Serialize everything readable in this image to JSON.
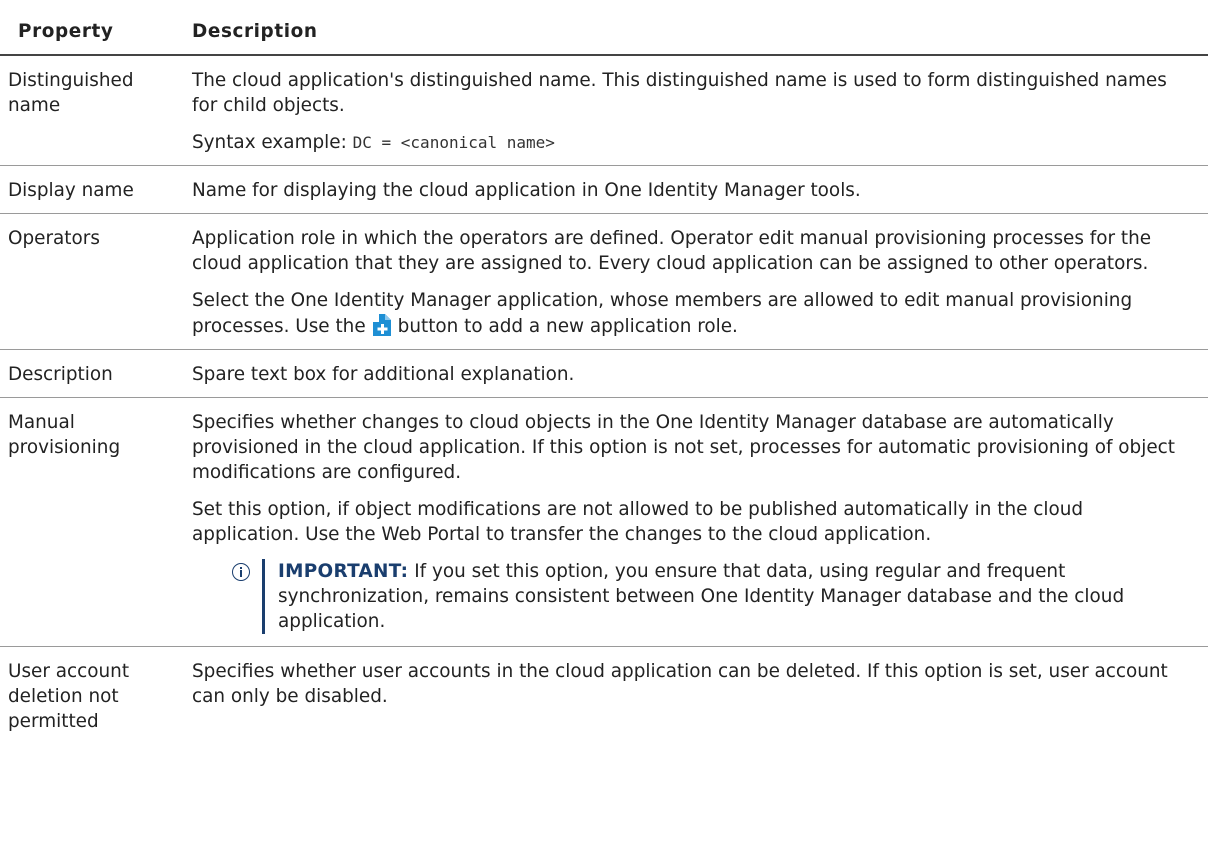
{
  "table": {
    "headers": {
      "property": "Property",
      "description": "Description"
    },
    "rows": [
      {
        "property": "Distinguished name",
        "paragraphs": [
          "The cloud application's distinguished name. This distinguished name is used to form distinguished names for child objects."
        ],
        "syntax": {
          "label": "Syntax example: ",
          "code": "DC = <canonical name>"
        }
      },
      {
        "property": "Display name",
        "paragraphs": [
          "Name for displaying the cloud application in One Identity Manager tools."
        ]
      },
      {
        "property": "Operators",
        "paragraphs": [
          "Application role in which the operators are defined. Operator edit manual provisioning processes for the cloud application that they are assigned to. Every cloud application can be assigned to other operators."
        ],
        "icon_paragraph": {
          "before": "Select the One Identity Manager application, whose members are allowed to edit manual provisioning processes. Use the",
          "icon": "add-application-role-icon",
          "after": "button to add a new application role."
        }
      },
      {
        "property": "Description",
        "paragraphs": [
          "Spare text box for additional explanation."
        ]
      },
      {
        "property": "Manual provisioning",
        "paragraphs": [
          "Specifies whether changes to cloud objects in the One Identity Manager database are automatically provisioned in the cloud application. If this option is not set, processes for automatic provisioning of object modifications are configured.",
          "Set this option, if object modifications are not allowed to be published automatically in the cloud application. Use the Web Portal to transfer the changes to the cloud application."
        ],
        "note": {
          "icon": "info-icon",
          "label": "IMPORTANT:",
          "text": "If you set this option, you ensure that data, using regular and frequent synchronization, remains consistent between One Identity Manager database and the cloud application."
        }
      },
      {
        "property": "User account deletion not permitted",
        "paragraphs": [
          "Specifies whether user accounts in the cloud application can be deleted. If this option is set, user account can only be disabled."
        ]
      }
    ]
  },
  "colors": {
    "note_accent": "#1a3e6e",
    "icon_blue": "#1e8fd4",
    "text": "#222222"
  }
}
